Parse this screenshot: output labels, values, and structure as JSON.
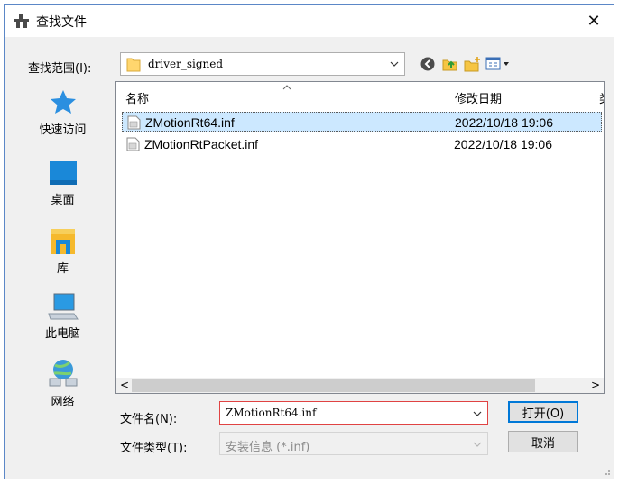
{
  "window": {
    "title": "查找文件",
    "close_glyph": "✕"
  },
  "lookin": {
    "label": "查找范围(I):",
    "value": "driver_signed"
  },
  "toolbar": {
    "icons": [
      "back-icon",
      "up-folder-icon",
      "new-folder-icon",
      "view-menu-icon"
    ]
  },
  "places": [
    {
      "label": "快速访问",
      "icon": "star-icon"
    },
    {
      "label": "桌面",
      "icon": "desktop-icon"
    },
    {
      "label": "库",
      "icon": "library-icon"
    },
    {
      "label": "此电脑",
      "icon": "computer-icon"
    },
    {
      "label": "网络",
      "icon": "network-icon"
    }
  ],
  "filelist": {
    "columns": {
      "name": "名称",
      "date": "修改日期",
      "clipped": "类"
    },
    "files": [
      {
        "name": "ZMotionRt64.inf",
        "date": "2022/10/18 19:06",
        "selected": true
      },
      {
        "name": "ZMotionRtPacket.inf",
        "date": "2022/10/18 19:06",
        "selected": false
      }
    ],
    "scroll_left": "<",
    "scroll_right": ">"
  },
  "filename": {
    "label": "文件名(N):",
    "value": "ZMotionRt64.inf"
  },
  "filetype": {
    "label": "文件类型(T):",
    "value": "安装信息 (*.inf)"
  },
  "buttons": {
    "open": "打开(O)",
    "cancel": "取消"
  },
  "colors": {
    "accent": "#0078d7",
    "selection": "#cce8ff",
    "focus_border": "#e04343",
    "window_bg": "#f0f0f0"
  }
}
